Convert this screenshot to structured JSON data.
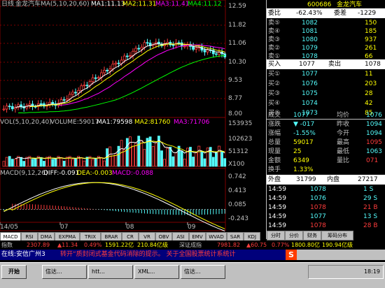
{
  "chart_header": {
    "period": "日线",
    "stock": "金龙汽车",
    "ma_label": "MA(5,10,20,60)",
    "ma1": "MA1:11.13",
    "ma2": "MA2:11.31",
    "ma3": "MA3:11.41",
    "ma4": "MA4:11.12"
  },
  "price_axis": [
    "12.59",
    "11.82",
    "11.06",
    "10.30",
    "9.53",
    "8.77",
    "8.00"
  ],
  "vol_header": {
    "label": "VOL(5,10,20,40)",
    "volume": "VOLUME:59017",
    "ma1": "MA1:79598",
    "ma2": "MA2:81760",
    "ma3": "MA3:71706"
  },
  "vol_axis": [
    "153935",
    "102623",
    "51312",
    "X100"
  ],
  "macd_header": {
    "label": "MACD(9,12,26)",
    "diff": "DIFF:-0.091",
    "dea": "DEA:-0.003",
    "macd": "MACD:-0.088"
  },
  "macd_axis": [
    "0.742",
    "0.413",
    "0.085",
    "-0.243"
  ],
  "date_axis": [
    "14/05",
    "07",
    "08",
    "09"
  ],
  "bottom_tabs": [
    "MACD",
    "RSI",
    "DMA",
    "EXPMA",
    "TRIX",
    "BRAR",
    "CR",
    "VR",
    "OBV",
    "ASI",
    "EMV",
    "WVAD",
    "SAR",
    "KDJ"
  ],
  "quote": {
    "code": "600686",
    "name": "金龙汽车",
    "webi_label": "委比",
    "webi_value": "-62.43%",
    "weicha_label": "委差",
    "weicha_value": "-1229",
    "sells": [
      {
        "label": "卖⑤",
        "price": "1082",
        "vol": "150"
      },
      {
        "label": "卖④",
        "price": "1081",
        "vol": "185"
      },
      {
        "label": "卖③",
        "price": "1080",
        "vol": "937"
      },
      {
        "label": "卖②",
        "price": "1079",
        "vol": "261"
      },
      {
        "label": "卖①",
        "price": "1078",
        "vol": "66"
      }
    ],
    "buy1_label": "买入",
    "buy1_price": "1077",
    "sell1_label": "卖出",
    "sell1_price": "1078",
    "buys": [
      {
        "label": "买①",
        "price": "1077",
        "vol": "11"
      },
      {
        "label": "买②",
        "price": "1076",
        "vol": "203"
      },
      {
        "label": "买③",
        "price": "1075",
        "vol": "28"
      },
      {
        "label": "买④",
        "price": "1074",
        "vol": "42"
      },
      {
        "label": "买⑤",
        "price": "1073",
        "vol": "85"
      }
    ],
    "stats_left": [
      {
        "label": "成交",
        "value": "1077"
      },
      {
        "label": "涨跌",
        "value": "▼ -017"
      },
      {
        "label": "涨幅",
        "value": "-1.55%"
      },
      {
        "label": "总量",
        "value": "59017"
      },
      {
        "label": "现量",
        "value": "25"
      },
      {
        "label": "金额",
        "value": "6349"
      },
      {
        "label": "换手",
        "value": "1.33%"
      }
    ],
    "stats_right": [
      {
        "label": "均价",
        "value": "1076"
      },
      {
        "label": "昨收",
        "value": "1094"
      },
      {
        "label": "今开",
        "value": "1094"
      },
      {
        "label": "最高",
        "value": "1095"
      },
      {
        "label": "最低",
        "value": "1063"
      },
      {
        "label": "量比",
        "value": "071"
      },
      {
        "label": "",
        "value": ""
      }
    ],
    "waipan_label": "外盘",
    "waipan_value": "31799",
    "neipan_label": "内盘",
    "neipan_value": "27217",
    "ticks": [
      {
        "time": "14:59",
        "price": "1078",
        "vol": "1 S"
      },
      {
        "time": "14:59",
        "price": "1076",
        "vol": "29 S"
      },
      {
        "time": "14:59",
        "price": "1078",
        "vol": "21 B"
      },
      {
        "time": "14:59",
        "price": "1077",
        "vol": "13 S"
      },
      {
        "time": "14:59",
        "price": "1078",
        "vol": "28 B"
      }
    ],
    "panel_tabs": [
      "分时",
      "分价",
      "财务",
      "筹码分布"
    ]
  },
  "index_bar": {
    "sh_label": "指数",
    "sh_value": "2307.89",
    "sh_change": "▲11.34",
    "sh_pct": "0.49%",
    "sh_amount": "1591.22亿",
    "sh_lead": "210.84亿级",
    "sz_label": "深证成指",
    "sz_value": "7981.82",
    "sz_change": "▲60.75",
    "sz_pct": "0.77%",
    "sz_amount": "1800.80亿",
    "sz_lead": "190.94亿级"
  },
  "ticker": {
    "left_label": "在线:安信广州3",
    "text": "转开“质封闭式基金代码消除的提示。    关于全国股票统计系统计"
  },
  "taskbar": {
    "start": "开始",
    "buttons": [
      "信达...",
      "htt...",
      "XML...",
      "信达..."
    ],
    "clock": "18:19"
  },
  "colors": {
    "bg": "#000000",
    "up": "#ff3c3c",
    "down": "#54fcfc",
    "ma1": "#ffffff",
    "ma2": "#ffff00",
    "ma3": "#ff00ff",
    "ma4": "#00ff00",
    "grid": "#800000"
  }
}
